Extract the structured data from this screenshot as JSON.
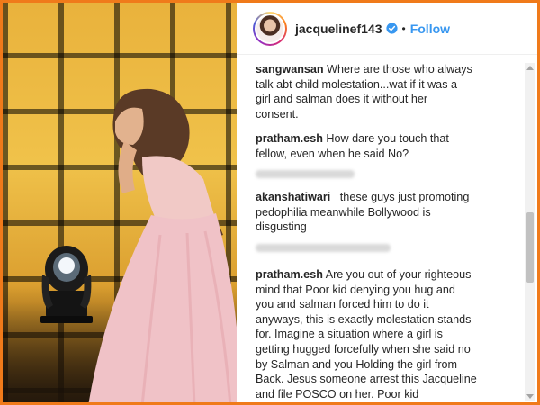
{
  "post": {
    "username": "jacquelinef143",
    "verified_icon": "verified-badge-icon",
    "separator": "•",
    "follow_label": "Follow",
    "accent_color": "#3897f0"
  },
  "comments": [
    {
      "user": "sangwansan",
      "lines": [
        " Where are those who always",
        "talk abt child molestation...wat if it was a",
        "girl and salman does it without her",
        "consent."
      ]
    },
    {
      "user": "pratham.esh",
      "lines": [
        " How dare you touch that",
        "fellow, even when he said No?"
      ]
    },
    {
      "user": "akanshatiwari_",
      "lines": [
        " these guys just promoting",
        "pedophilia meanwhile Bollywood is",
        "disgusting"
      ]
    },
    {
      "user": "pratham.esh",
      "lines": [
        " Are you out of your righteous",
        "mind that Poor kid denying you hug and",
        "you and salman forced him to do it",
        "anyways, this is exactly molestation stands",
        "for. Imagine a situation where a girl is",
        "getting hugged forcefully when she said no",
        "by Salman and you Holding the girl from",
        "Back. Jesus someone arrest this Jacqueline",
        "and file POSCO on her. Poor kid"
      ]
    }
  ],
  "frame_color": "#f07a1a"
}
